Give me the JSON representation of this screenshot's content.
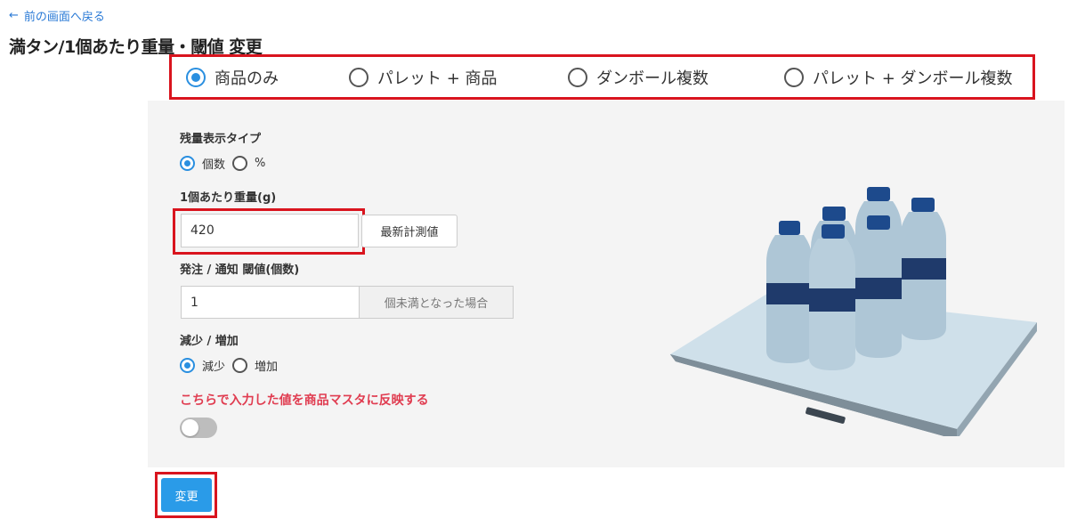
{
  "header": {
    "back_arrow": "←",
    "back_label": "前の画面へ戻る",
    "title": "満タン/1個あたり重量・閾値 変更"
  },
  "measure_types": {
    "options": [
      {
        "label": "商品のみ",
        "checked": true
      },
      {
        "label": "パレット + 商品",
        "checked": false
      },
      {
        "label": "ダンボール複数",
        "checked": false
      },
      {
        "label": "パレット + ダンボール複数",
        "checked": false
      }
    ]
  },
  "form": {
    "display_type_label": "残量表示タイプ",
    "display_type_options": [
      {
        "label": "個数",
        "checked": true
      },
      {
        "label": "%",
        "checked": false
      }
    ],
    "unit_weight_label": "1個あたり重量(g)",
    "unit_weight_value": "420",
    "measure_button_label": "最新計測値",
    "threshold_label": "発注 / 通知 閾値(個数)",
    "threshold_value": "1",
    "threshold_suffix": "個未満となった場合",
    "direction_label": "減少 / 増加",
    "direction_options": [
      {
        "label": "減少",
        "checked": true
      },
      {
        "label": "増加",
        "checked": false
      }
    ],
    "reflect_text": "こちらで入力した値を商品マスタに反映する",
    "reflect_toggle_on": false
  },
  "actions": {
    "submit_label": "変更"
  },
  "colors": {
    "accent_blue": "#2a8fe0",
    "highlight_red": "#d9141e",
    "warning_pink": "#e03c50",
    "panel_bg": "#f4f4f4"
  }
}
